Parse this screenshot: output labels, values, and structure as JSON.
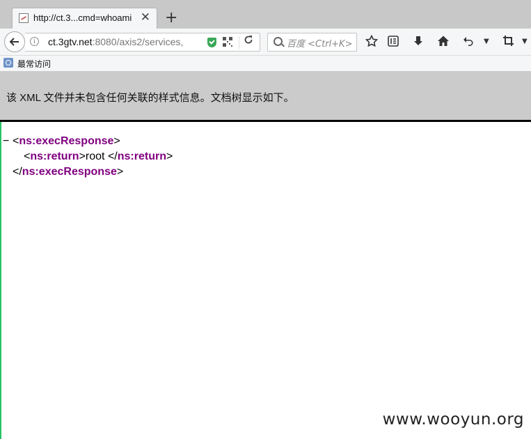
{
  "browser": {
    "tab_title": "http://ct.3...cmd=whoami",
    "tab_close": "✕",
    "new_tab": "+",
    "url_host": "ct.3gtv.net",
    "url_rest": ":8080/axis2/services,",
    "search_placeholder": "百度 <Ctrl+K>",
    "bookmark_label": "最常访问"
  },
  "xml_notice": "该 XML 文件并未包含任何关联的样式信息。文档树显示如下。",
  "xml_tree": {
    "collapse_symbol": "−",
    "open_tag": "ns:execResponse",
    "child_tag": "ns:return",
    "child_value": "root ",
    "close_tag": "ns:execResponse"
  },
  "watermark": "www.wooyun.org"
}
